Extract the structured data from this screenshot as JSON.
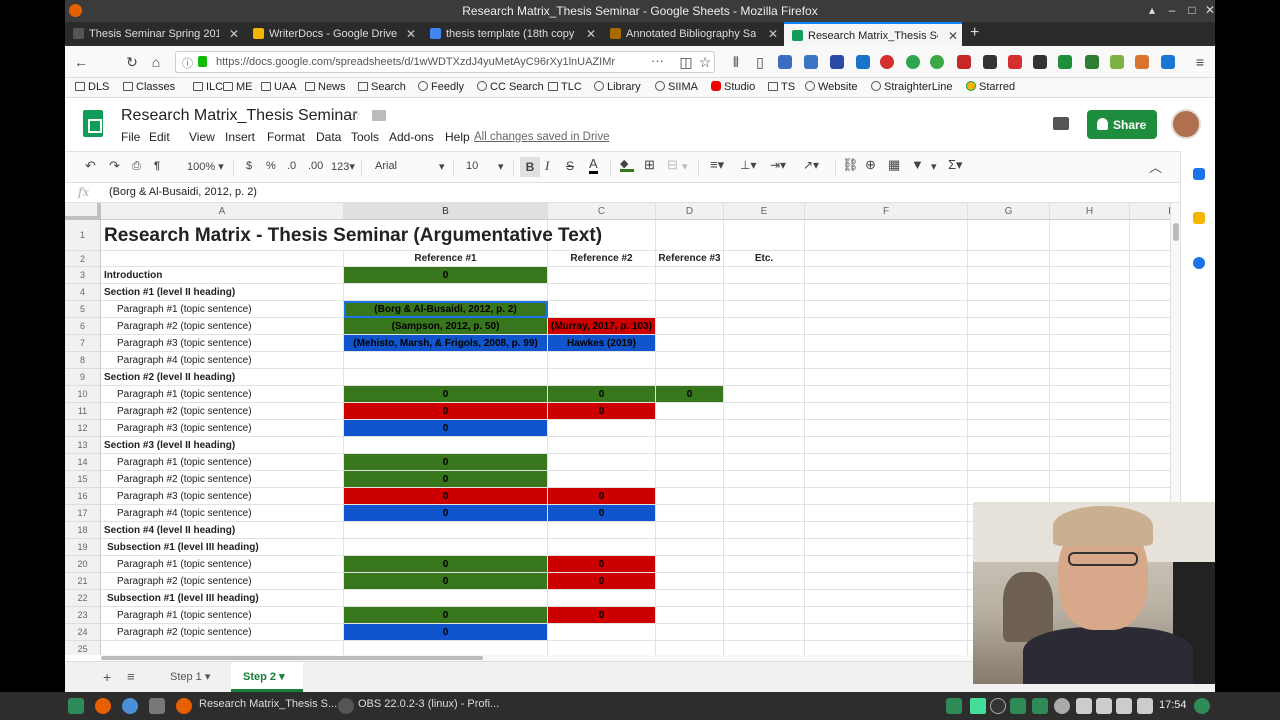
{
  "window": {
    "title": "Research Matrix_Thesis Seminar - Google Sheets - Mozilla Firefox"
  },
  "tabs": [
    {
      "label": "Thesis Seminar Spring 201",
      "color": "#555555"
    },
    {
      "label": "WriterDocs - Google Drive",
      "color": "#f4b400"
    },
    {
      "label": "thesis template (18th copy",
      "color": "#4285f4"
    },
    {
      "label": "Annotated Bibliography Sa",
      "color": "#a86b00"
    },
    {
      "label": "Research Matrix_Thesis Se",
      "color": "#0f9d58"
    }
  ],
  "nav": {
    "url": "https://docs.google.com/spreadsheets/d/1wWDTXzdJ4yuMetAyC96rXy1lnUAZIMr"
  },
  "bookmarks": [
    {
      "label": "DLS",
      "icon": "folder-icon"
    },
    {
      "label": "Classes",
      "icon": "folder-icon"
    },
    {
      "label": "ILC",
      "icon": "folder-icon"
    },
    {
      "label": "ME",
      "icon": "folder-icon"
    },
    {
      "label": "UAA",
      "icon": "folder-icon"
    },
    {
      "label": "News",
      "icon": "folder-icon"
    },
    {
      "label": "Search",
      "icon": "folder-icon"
    },
    {
      "label": "Feedly",
      "icon": "globe-icon"
    },
    {
      "label": "CC Search",
      "icon": "globe-icon"
    },
    {
      "label": "TLC",
      "icon": "folder-icon"
    },
    {
      "label": "Library",
      "icon": "globe-icon"
    },
    {
      "label": "SIIMA",
      "icon": "globe-icon"
    },
    {
      "label": "Studio",
      "icon": "youtube-icon"
    },
    {
      "label": "TS",
      "icon": "folder-icon"
    },
    {
      "label": "Website",
      "icon": "site-icon"
    },
    {
      "label": "StraighterLine",
      "icon": "globe-icon"
    },
    {
      "label": "Starred",
      "icon": "drive-icon"
    }
  ],
  "doc": {
    "title": "Research Matrix_Thesis Seminar",
    "saved": "All changes saved in Drive",
    "share": "Share"
  },
  "menus": [
    "File",
    "Edit",
    "View",
    "Insert",
    "Format",
    "Data",
    "Tools",
    "Add-ons",
    "Help"
  ],
  "toolbar": {
    "zoom": "100%",
    "currency": "$",
    "percent": "%",
    "dec_less": ".0",
    "dec_more": ".00",
    "format": "123",
    "font": "Arial",
    "size": "10",
    "bold": "B",
    "italic": "I",
    "strike": "S",
    "textcolor": "A",
    "sigma": "Σ"
  },
  "formula_bar": {
    "fx": "fx",
    "value": "(Borg & Al-Busaidi, 2012, p. 2)"
  },
  "columns": [
    "A",
    "B",
    "C",
    "D",
    "E",
    "F",
    "G",
    "H",
    "I"
  ],
  "rows": [
    {
      "n": "1",
      "a": "Research Matrix - Thesis Seminar (Argumentative Text)",
      "style": "title"
    },
    {
      "n": "2",
      "a": "",
      "b": "Reference #1",
      "c": "Reference #2",
      "d": "Reference #3",
      "e": "Etc.",
      "style": "header"
    },
    {
      "n": "3",
      "a": "Introduction",
      "b": "0",
      "style": "section",
      "fills": {
        "b": "g"
      }
    },
    {
      "n": "4",
      "a": "Section #1 (level II heading)",
      "style": "section"
    },
    {
      "n": "5",
      "a": "Paragraph #1 (topic sentence)",
      "b": "(Borg & Al-Busaidi, 2012, p. 2)",
      "style": "para",
      "fills": {
        "b": "g"
      },
      "selected": true
    },
    {
      "n": "6",
      "a": "Paragraph #2 (topic sentence)",
      "b": "(Sampson, 2012, p. 50)",
      "c": "(Murray, 2017, p. 103)",
      "style": "para",
      "fills": {
        "b": "g",
        "c": "r"
      }
    },
    {
      "n": "7",
      "a": "Paragraph #3 (topic sentence)",
      "b": "(Mehisto, Marsh, & Frigols, 2008, p. 99)",
      "c": "Hawkes (2019)",
      "style": "para",
      "fills": {
        "b": "b",
        "c": "b"
      }
    },
    {
      "n": "8",
      "a": "Paragraph #4 (topic sentence)",
      "style": "para"
    },
    {
      "n": "9",
      "a": "Section #2 (level II heading)",
      "style": "section"
    },
    {
      "n": "10",
      "a": "Paragraph #1 (topic sentence)",
      "b": "0",
      "c": "0",
      "d": "0",
      "style": "para",
      "fills": {
        "b": "g",
        "c": "g",
        "d": "g"
      }
    },
    {
      "n": "11",
      "a": "Paragraph #2 (topic sentence)",
      "b": "0",
      "c": "0",
      "style": "para",
      "fills": {
        "b": "r",
        "c": "r"
      }
    },
    {
      "n": "12",
      "a": "Paragraph #3 (topic sentence)",
      "b": "0",
      "style": "para",
      "fills": {
        "b": "b"
      }
    },
    {
      "n": "13",
      "a": "Section #3 (level II heading)",
      "style": "section"
    },
    {
      "n": "14",
      "a": "Paragraph #1 (topic sentence)",
      "b": "0",
      "style": "para",
      "fills": {
        "b": "g"
      }
    },
    {
      "n": "15",
      "a": "Paragraph #2 (topic sentence)",
      "b": "0",
      "style": "para",
      "fills": {
        "b": "g"
      }
    },
    {
      "n": "16",
      "a": "Paragraph #3 (topic sentence)",
      "b": "0",
      "c": "0",
      "style": "para",
      "fills": {
        "b": "r",
        "c": "r"
      }
    },
    {
      "n": "17",
      "a": "Paragraph #4 (topic sentence)",
      "b": "0",
      "c": "0",
      "style": "para",
      "fills": {
        "b": "b",
        "c": "b"
      }
    },
    {
      "n": "18",
      "a": "Section #4 (level II heading)",
      "style": "section"
    },
    {
      "n": "19",
      "a": "Subsection #1 (level III heading)",
      "style": "subsection"
    },
    {
      "n": "20",
      "a": "Paragraph #1 (topic sentence)",
      "b": "0",
      "c": "0",
      "style": "para",
      "fills": {
        "b": "g",
        "c": "r"
      }
    },
    {
      "n": "21",
      "a": "Paragraph #2 (topic sentence)",
      "b": "0",
      "c": "0",
      "style": "para",
      "fills": {
        "b": "g",
        "c": "r"
      }
    },
    {
      "n": "22",
      "a": "Subsection #1 (level III heading)",
      "style": "subsection"
    },
    {
      "n": "23",
      "a": "Paragraph #1 (topic sentence)",
      "b": "0",
      "c": "0",
      "style": "para",
      "fills": {
        "b": "g",
        "c": "r"
      }
    },
    {
      "n": "24",
      "a": "Paragraph #2 (topic sentence)",
      "b": "0",
      "style": "para",
      "fills": {
        "b": "b"
      }
    },
    {
      "n": "25",
      "a": "",
      "style": "para"
    }
  ],
  "sheet_tabs": [
    {
      "label": "Step 1",
      "active": false
    },
    {
      "label": "Step 2",
      "active": true
    }
  ],
  "taskbar": {
    "apps": [
      {
        "label": "Research Matrix_Thesis S..."
      },
      {
        "label": "OBS 22.0.2-3 (linux) - Profi..."
      }
    ],
    "time": "17:54"
  },
  "colors": {
    "green": "#38761d",
    "red": "#cc0000",
    "blue": "#1155cc",
    "accent": "#1a73e8",
    "share": "#1e8e3e"
  }
}
